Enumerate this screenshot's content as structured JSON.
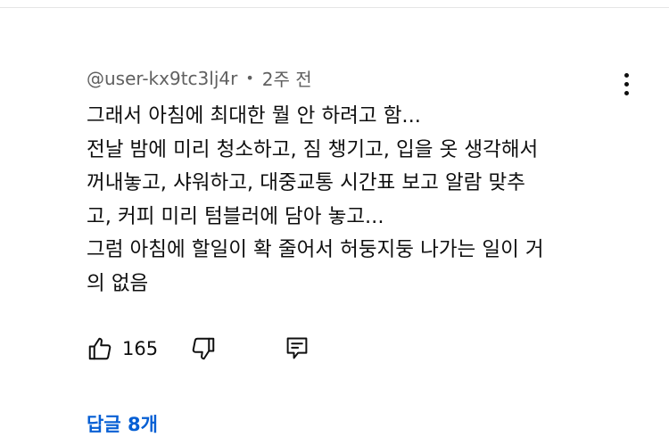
{
  "comment": {
    "author": "@user-kx9tc3lj4r",
    "separator": "•",
    "time_ago": "2주 전",
    "text_lines": [
      "그래서 아침에 최대한 뭘 안 하려고 함...",
      "전날 밤에 미리 청소하고, 짐 챙기고, 입을 옷 생각해서",
      "꺼내놓고, 샤워하고, 대중교통 시간표 보고 알람 맞추",
      "고, 커피 미리 텀블러에 담아 놓고...",
      "그럼 아침에 할일이 확 줄어서 허둥지둥 나가는 일이 거",
      "의 없음"
    ],
    "like_count": "165",
    "replies_label": "답글 8개"
  },
  "icons": {
    "like": "thumbs-up-icon",
    "dislike": "thumbs-down-icon",
    "reply": "reply-comment-icon",
    "menu": "more-vert-icon"
  },
  "colors": {
    "text": "#0f0f0f",
    "meta": "#606060",
    "link": "#065fd4"
  }
}
